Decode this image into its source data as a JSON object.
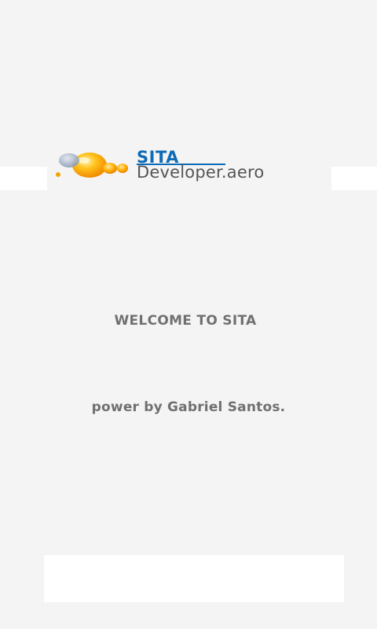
{
  "logo": {
    "brand": "SITA",
    "domain": "Developer.aero"
  },
  "welcome_text": "WELCOME TO SITA",
  "credit_text": "power by Gabriel Santos.",
  "colors": {
    "background": "#f4f4f4",
    "panel": "#ffffff",
    "brand_blue": "#0e6bb6",
    "domain_gray": "#555555",
    "text_gray": "#707070",
    "bubble_orange": "#f5a300"
  },
  "icons": {
    "logo_graphic": "orange-bubbles-icon"
  }
}
